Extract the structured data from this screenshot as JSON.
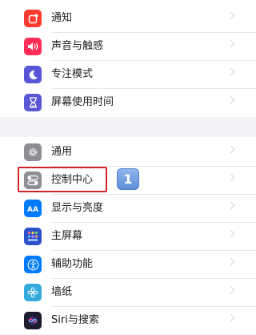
{
  "colors": {
    "background": "#f2f2f7",
    "highlight_border": "#d2232a",
    "badge": "#6b9be0"
  },
  "group1": {
    "items": [
      {
        "label": "通知",
        "icon": "notifications-icon",
        "icon_color": "#ff3b30"
      },
      {
        "label": "声音与触感",
        "icon": "sound-icon",
        "icon_color": "#ff2d55"
      },
      {
        "label": "专注模式",
        "icon": "moon-icon",
        "icon_color": "#5856d6"
      },
      {
        "label": "屏幕使用时间",
        "icon": "hourglass-icon",
        "icon_color": "#5856d6"
      }
    ]
  },
  "group2": {
    "items": [
      {
        "label": "通用",
        "icon": "gear-icon",
        "icon_color": "#8e8e93"
      },
      {
        "label": "控制中心",
        "icon": "control-center-icon",
        "icon_color": "#8e8e93"
      },
      {
        "label": "显示与亮度",
        "icon": "display-icon",
        "icon_color": "#007aff"
      },
      {
        "label": "主屏幕",
        "icon": "home-screen-icon",
        "icon_color": "#2c52c9"
      },
      {
        "label": "辅助功能",
        "icon": "accessibility-icon",
        "icon_color": "#007aff"
      },
      {
        "label": "墙纸",
        "icon": "wallpaper-icon",
        "icon_color": "#34aadc"
      },
      {
        "label": "Siri与搜索",
        "icon": "siri-icon",
        "icon_color": "#1c1c2e"
      }
    ]
  },
  "annotation": {
    "step_number": "1"
  }
}
